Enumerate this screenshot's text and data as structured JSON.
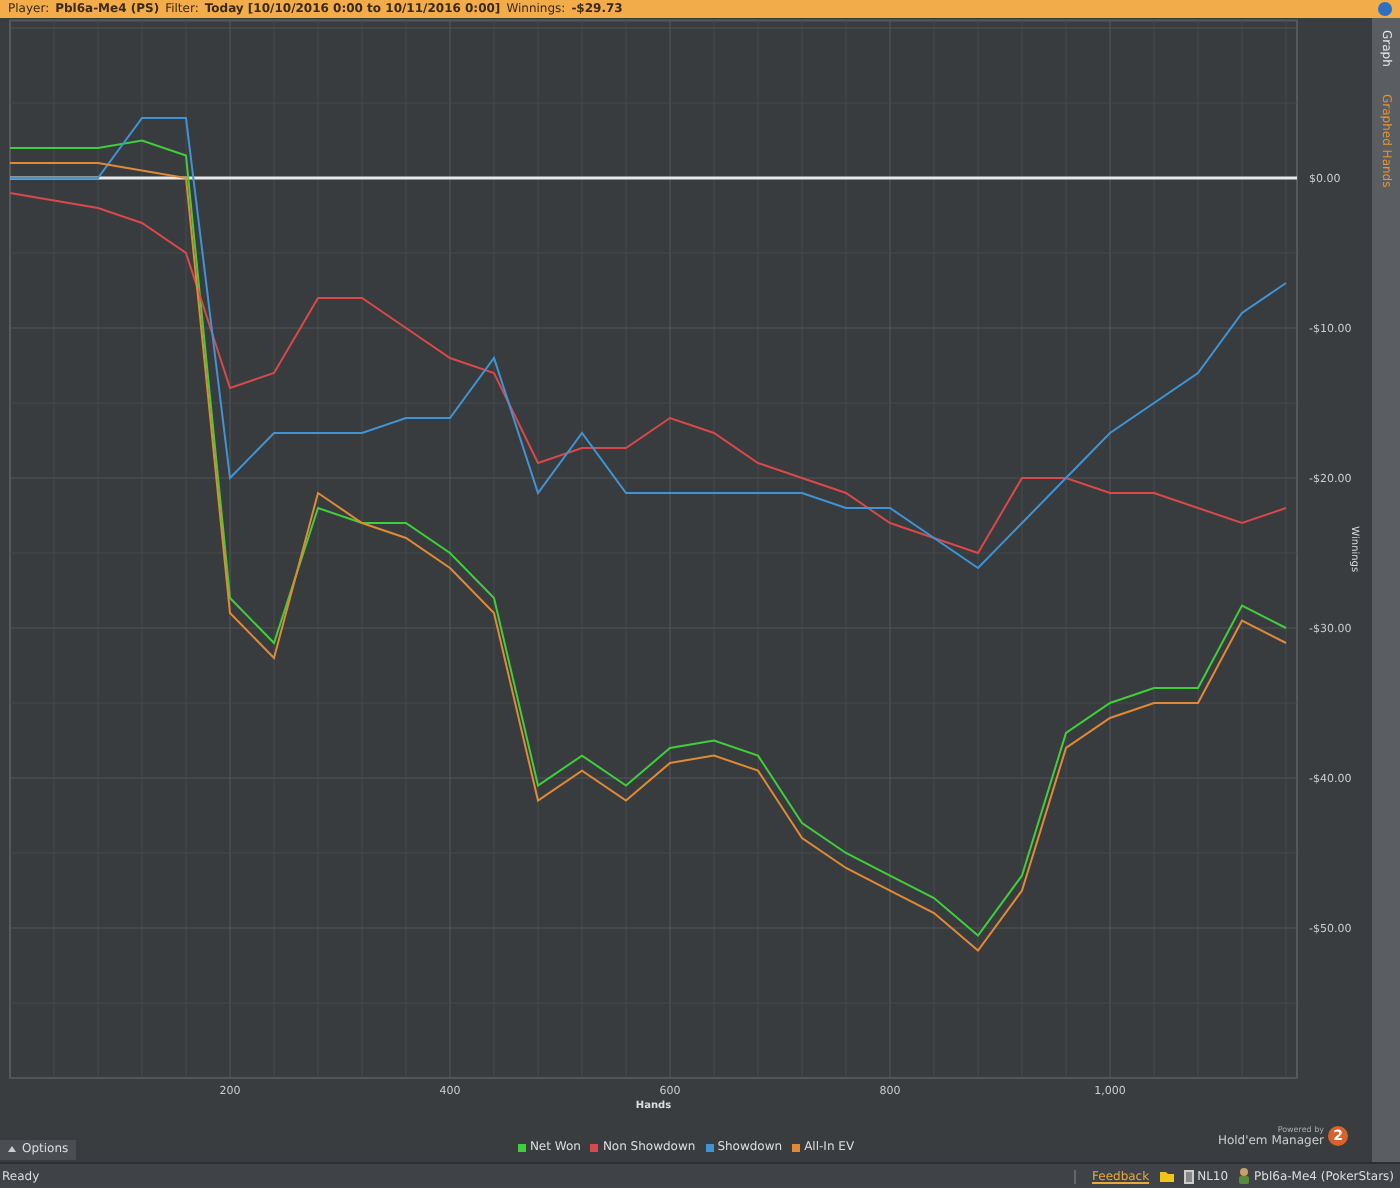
{
  "header": {
    "player_label": "Player:",
    "player": "Pbl6a-Me4 (PS)",
    "filter_label": "Filter:",
    "filter": "Today [10/10/2016 0:00 to 10/11/2016 0:00]",
    "winnings_label": "Winnings:",
    "winnings": "-$29.73"
  },
  "side_tabs": [
    {
      "label": "Graph",
      "selected": true
    },
    {
      "label": "Graphed Hands",
      "selected": false
    }
  ],
  "chart_data": {
    "type": "line",
    "xlabel": "Hands",
    "ylabel": "Winnings",
    "x": [
      0,
      40,
      80,
      120,
      160,
      200,
      240,
      280,
      320,
      360,
      400,
      440,
      480,
      520,
      560,
      600,
      640,
      680,
      720,
      760,
      800,
      840,
      880,
      920,
      960,
      1000,
      1040,
      1080,
      1120,
      1160
    ],
    "grid": true,
    "xlim": [
      0,
      1170
    ],
    "ylim": [
      -60,
      10.5
    ],
    "xticks": [
      200,
      400,
      600,
      800,
      {
        "value": 1000,
        "label": "1,000"
      }
    ],
    "yticks": [
      {
        "value": 0,
        "label": "$0.00"
      },
      {
        "value": -10,
        "label": "-$10.00"
      },
      {
        "value": -20,
        "label": "-$20.00"
      },
      {
        "value": -30,
        "label": "-$30.00"
      },
      {
        "value": -40,
        "label": "-$40.00"
      },
      {
        "value": -50,
        "label": "-$50.00"
      }
    ],
    "series": [
      {
        "name": "Net Won",
        "color": "#3fcf3a",
        "values": [
          2,
          2,
          2,
          2.5,
          1.5,
          -28,
          -31,
          -22,
          -23,
          -23,
          -25,
          -28,
          -40.5,
          -38.5,
          -40.5,
          -38,
          -37.5,
          -38.5,
          -43,
          -45,
          -46.5,
          -48,
          -50.5,
          -46.5,
          -37,
          -35,
          -34,
          -34,
          -28.5,
          -30
        ]
      },
      {
        "name": "Non Showdown",
        "color": "#d9484a",
        "values": [
          -1,
          -1.5,
          -2,
          -3,
          -5,
          -14,
          -13,
          -8,
          -8,
          -10,
          -12,
          -13,
          -19,
          -18,
          -18,
          -16,
          -17,
          -19,
          -20,
          -21,
          -23,
          -24,
          -25,
          -20,
          -20,
          -21,
          -21,
          -22,
          -23,
          -22
        ]
      },
      {
        "name": "Showdown",
        "color": "#3f94d6",
        "values": [
          0,
          0,
          0,
          4,
          4,
          -20,
          -17,
          -17,
          -17,
          -16,
          -16,
          -12,
          -21,
          -17,
          -21,
          -21,
          -21,
          -21,
          -21,
          -22,
          -22,
          -24,
          -26,
          -23,
          -20,
          -17,
          -15,
          -13,
          -9,
          -7
        ]
      },
      {
        "name": "All-In EV",
        "color": "#e08a35",
        "values": [
          1,
          1,
          1,
          0.5,
          0,
          -29,
          -32,
          -21,
          -23,
          -24,
          -26,
          -29,
          -41.5,
          -39.5,
          -41.5,
          -39,
          -38.5,
          -39.5,
          -44,
          -46,
          -47.5,
          -49,
          -51.5,
          -47.5,
          -38,
          -36,
          -35,
          -35,
          -29.5,
          -31
        ]
      }
    ]
  },
  "options_button": "Options",
  "branding": {
    "powered_by": "Powered by",
    "product": "Hold'em Manager",
    "version": "2"
  },
  "status_bar": {
    "status": "Ready",
    "feedback": "Feedback",
    "stakes": "NL10",
    "account": "Pbl6a-Me4 (PokerStars)"
  }
}
